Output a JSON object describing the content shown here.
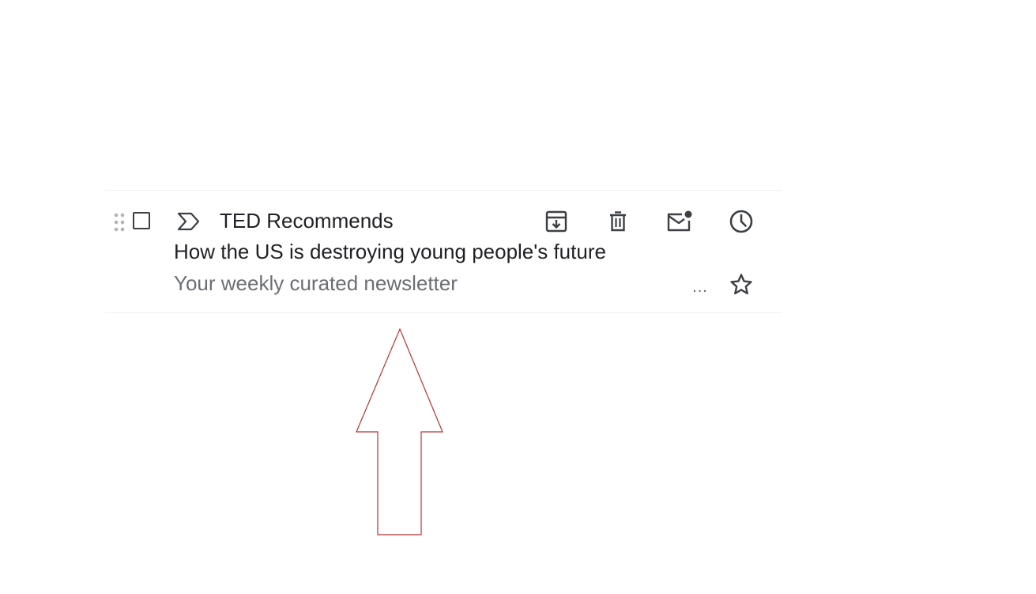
{
  "email": {
    "sender": "TED Recommends",
    "subject": "How the US is destroying young people's future",
    "snippet": "Your weekly curated newsletter",
    "more_label": "..."
  },
  "icons": {
    "drag": "drag-handle-icon",
    "checkbox": "checkbox-icon",
    "importance": "importance-marker-icon",
    "archive": "archive-icon",
    "delete": "trash-icon",
    "unread": "mark-unread-icon",
    "snooze": "clock-icon",
    "star": "star-icon"
  },
  "colors": {
    "text": "#202124",
    "snippet": "#6b6f73",
    "icon": "#3c4043",
    "divider": "#eceef1",
    "arrow": "#b83232"
  }
}
